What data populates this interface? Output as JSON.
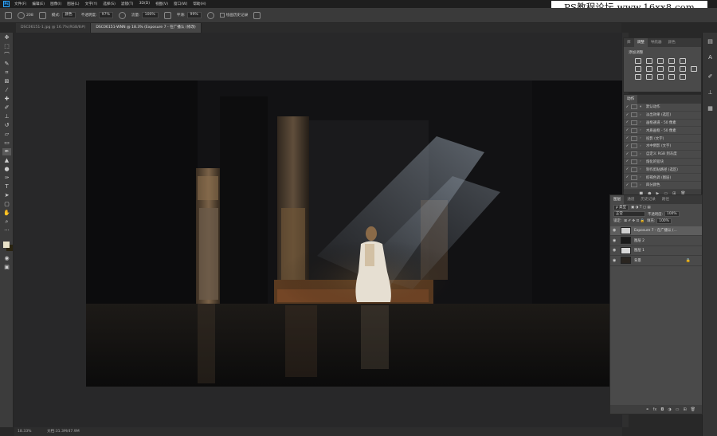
{
  "app": {
    "logo": "Ps"
  },
  "menu": [
    "文件(F)",
    "编辑(E)",
    "图像(I)",
    "图层(L)",
    "文字(Y)",
    "选择(S)",
    "滤镜(T)",
    "3D(D)",
    "视图(V)",
    "窗口(W)",
    "帮助(H)"
  ],
  "watermark": "PS教程论坛 www.16xx8.com",
  "options": {
    "brush_size": "208",
    "mode_label": "模式:",
    "mode_value": "颜色",
    "opacity_label": "不透明度:",
    "opacity_value": "97%",
    "flow_label": "流量:",
    "flow_value": "100%",
    "smooth_label": "平滑:",
    "smooth_value": "99%",
    "history_label": "绘画历史记录"
  },
  "tabs": [
    {
      "label": "DSC06151-1.jpg @ 16.7%(RGB/8#)",
      "active": false
    },
    {
      "label": "DSC06151-WNN @ 18.3% (Exposure 7 - 在广播认 (修改)",
      "active": true
    }
  ],
  "status": {
    "zoom": "18.33%",
    "doc": "文档:31.3M/47.9M"
  },
  "adjustments": {
    "tabs": [
      "库",
      "调整",
      "导航器",
      "颜色"
    ],
    "active_tab": 1,
    "title": "添加调整"
  },
  "actions": {
    "tab": "动作",
    "rows": [
      "默认动作",
      "淡出效果 (选区)",
      "画框通道 - 50 像素",
      "木质画框 - 50 像素",
      "投影 (文字)",
      "水中倒影 (文字)",
      "自定义 RGB 到灰度",
      "熔化的铅块",
      "制作剪贴路径 (选区)",
      "棕褐色调 (图层)",
      "四分颜色"
    ]
  },
  "layers": {
    "tabs": [
      "图层",
      "通道",
      "历史记录",
      "路径"
    ],
    "active_tab": 0,
    "filter_label": "ρ 类型",
    "blend_mode": "正常",
    "opacity_label": "不透明度:",
    "opacity_value": "100%",
    "lock_label": "锁定:",
    "fill_label": "填充:",
    "fill_value": "100%",
    "items": [
      {
        "name": "Exposure 7 - 在广播认 (...",
        "selected": true,
        "thumb": "#cfcfcf"
      },
      {
        "name": "图层 2",
        "selected": false,
        "thumb": "#1a1a1a"
      },
      {
        "name": "图层 1",
        "selected": false,
        "thumb": "#d8d8d8"
      },
      {
        "name": "背景",
        "selected": false,
        "thumb": "#2a2520",
        "locked": true
      }
    ]
  },
  "colors": {
    "foreground": "#e9e2c8",
    "background": "#2a2410"
  }
}
